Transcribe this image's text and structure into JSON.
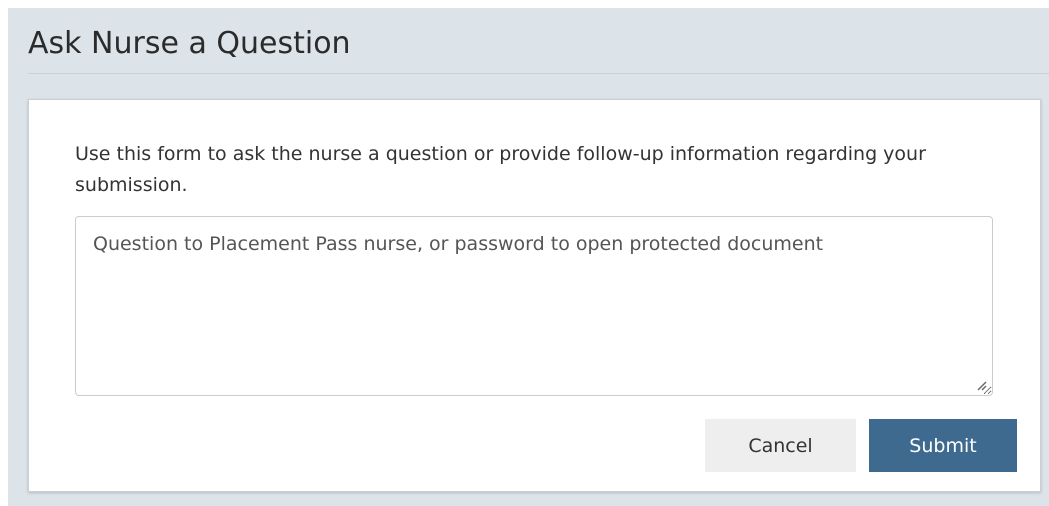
{
  "header": {
    "title": "Ask Nurse a Question"
  },
  "form": {
    "instructions": "Use this form to ask the nurse a question or provide follow-up information regarding your submission.",
    "question_placeholder": "Question to Placement Pass nurse, or password to open protected document",
    "question_value": "",
    "cancel_label": "Cancel",
    "submit_label": "Submit"
  },
  "colors": {
    "panel_background": "#dce4ea",
    "submit_button": "#3f6a8f",
    "cancel_button": "#eeeeee"
  }
}
